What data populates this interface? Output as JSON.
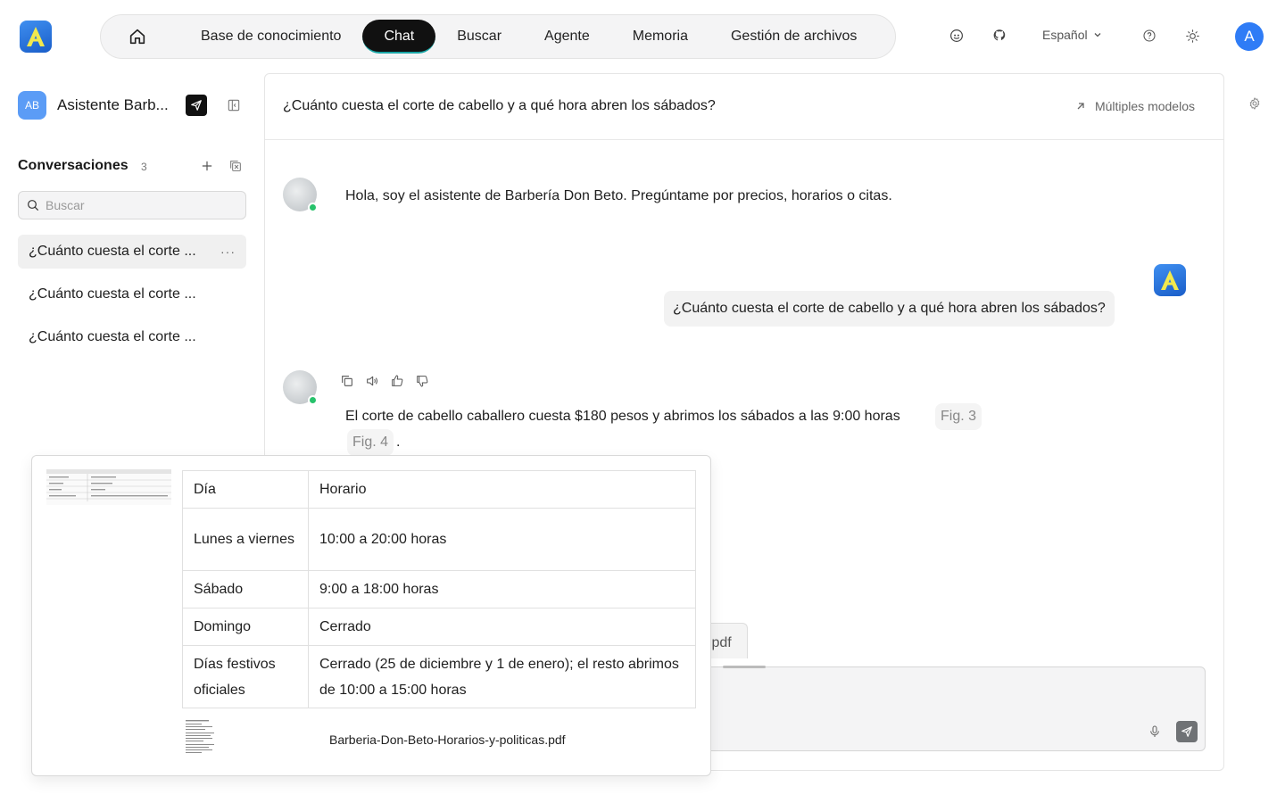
{
  "app": {
    "logo_letter": "A",
    "accent_color": "#2f7cf6"
  },
  "nav": {
    "home_icon": "home-icon",
    "items": [
      {
        "label": "Base de conocimiento",
        "active": false
      },
      {
        "label": "Chat",
        "active": true
      },
      {
        "label": "Buscar",
        "active": false
      },
      {
        "label": "Agente",
        "active": false
      },
      {
        "label": "Memoria",
        "active": false
      },
      {
        "label": "Gestión de archivos",
        "active": false
      }
    ]
  },
  "topbar": {
    "language": "Español",
    "user_initial": "A",
    "icons": [
      "discord-icon",
      "github-icon",
      "help-icon",
      "sun-icon"
    ]
  },
  "sidebar": {
    "badge": "AB",
    "assistant_name": "Asistente Barb...",
    "conversations_title": "Conversaciones",
    "conversations_count": "3",
    "search_placeholder": "Buscar",
    "conversations": [
      {
        "title": "¿Cuánto cuesta el corte ...",
        "active": true
      },
      {
        "title": "¿Cuánto cuesta el corte ...",
        "active": false
      },
      {
        "title": "¿Cuánto cuesta el corte ...",
        "active": false
      }
    ],
    "more_label": "···"
  },
  "chat": {
    "title": "¿Cuánto cuesta el corte de cabello y a qué hora abren los sábados?",
    "multi_models_label": "Múltiples modelos",
    "greeting": "Hola, soy el asistente de Barbería Don Beto. Pregúntame por precios, horarios o citas.",
    "user_question": "¿Cuánto cuesta el corte de cabello y a qué hora abren los sábados?",
    "answer": "El corte de cabello caballero cuesta $180 pesos y abrimos los sábados a las 9:00 horas",
    "citations": [
      "Fig. 3",
      "Fig. 4"
    ],
    "answer_end": ".",
    "attached_file_tab": ".pdf"
  },
  "popover": {
    "table": {
      "header": [
        "Día",
        "Horario"
      ],
      "rows": [
        [
          "Lunes a viernes",
          "10:00 a 20:00 horas"
        ],
        [
          "Sábado",
          "9:00 a 18:00 horas"
        ],
        [
          "Domingo",
          "Cerrado"
        ],
        [
          "Días festivos oficiales",
          "Cerrado (25 de diciembre y 1 de enero); el resto abrimos de 10:00 a 15:00 horas"
        ]
      ]
    },
    "file_name": "Barberia-Don-Beto-Horarios-y-politicas.pdf"
  }
}
